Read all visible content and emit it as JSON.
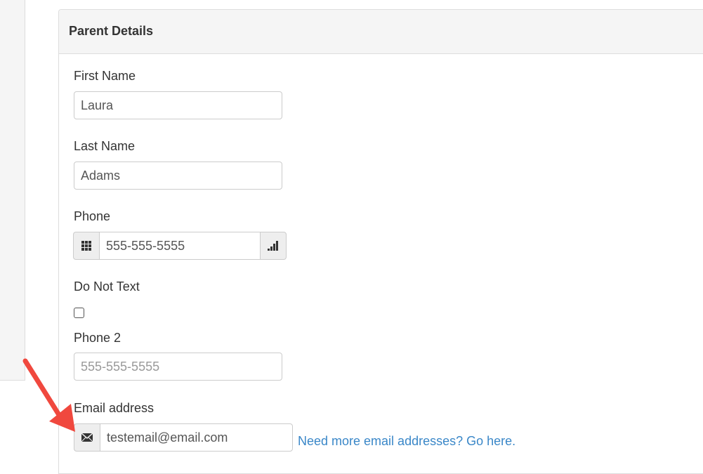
{
  "panel": {
    "title": "Parent Details"
  },
  "fields": {
    "first_name": {
      "label": "First Name",
      "value": "Laura"
    },
    "last_name": {
      "label": "Last Name",
      "value": "Adams"
    },
    "phone": {
      "label": "Phone",
      "value": "555-555-5555"
    },
    "do_not_text": {
      "label": "Do Not Text",
      "checked": false
    },
    "phone2": {
      "label": "Phone 2",
      "value": "",
      "placeholder": "555-555-5555"
    },
    "email": {
      "label": "Email address",
      "value": "testemail@email.com"
    }
  },
  "email_link": "Need more email addresses? Go here.",
  "icons": {
    "phone_prefix": "keypad-icon",
    "phone_suffix": "signal-icon",
    "email_prefix": "envelope-icon",
    "annotation": "red-arrow"
  },
  "colors": {
    "link": "#3a87c8",
    "arrow": "#f0483e",
    "addon_bg": "#eeeeee",
    "heading_bg": "#f5f5f5"
  }
}
